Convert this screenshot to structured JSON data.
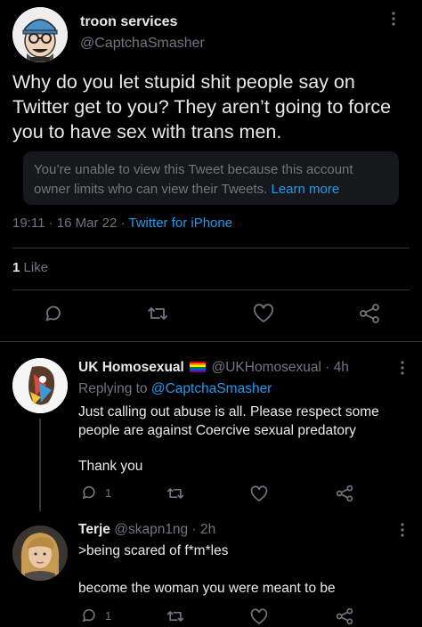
{
  "main_tweet": {
    "display_name": "troon services",
    "handle": "@CaptchaSmasher",
    "body": "Why do you let stupid shit people say on Twitter get to you? They aren’t going to force you to have sex with trans men.",
    "quoted_notice": "You’re unable to view this Tweet because this account owner limits who can view their Tweets.",
    "learn_more": "Learn more",
    "timestamp": "19:11 · 16 Mar 22 · ",
    "source": "Twitter for iPhone",
    "likes_count": "1",
    "likes_label": "Like"
  },
  "replies": [
    {
      "display_name": "UK Homosexual",
      "flag_emoji": "🏳️‍🌈",
      "handle": "@UKHomosexual · 4h",
      "replying_prefix": "Replying to ",
      "replying_to": "@CaptchaSmasher",
      "body_line1": "Just calling out abuse is all. Please respect some people are against Coercive sexual predatory",
      "body_line2": "Thank you",
      "reply_count": "1"
    },
    {
      "display_name": "Terje",
      "handle": "@skapn1ng · 2h",
      "body_line1": ">being scared of f*m*les",
      "body_line2": "become the woman you were meant to be",
      "reply_count": "1"
    }
  ],
  "colors": {
    "background": "#000000",
    "text": "#e7e9ea",
    "secondary": "#71767b",
    "accent": "#1d9bf0"
  },
  "icons": [
    "reply-icon",
    "retweet-icon",
    "like-icon",
    "share-icon",
    "more-icon"
  ]
}
